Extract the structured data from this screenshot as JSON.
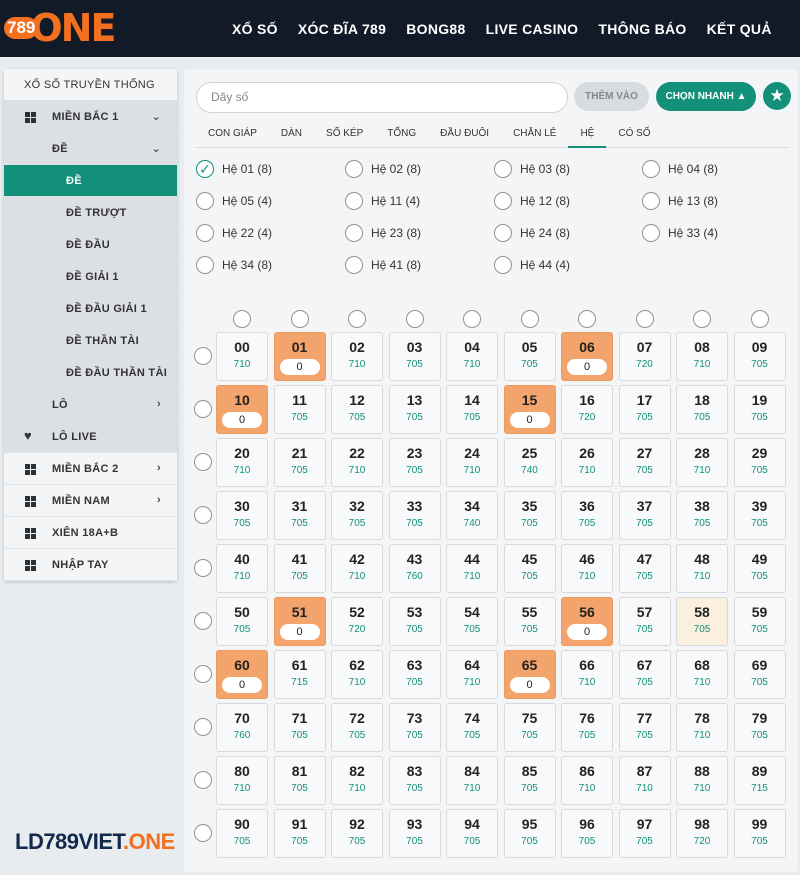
{
  "header": {
    "logo_num": "789",
    "logo_text": "ONE",
    "nav": [
      "XỔ SỐ",
      "XÓC ĐĨA 789",
      "BONG88",
      "LIVE CASINO",
      "THÔNG BÁO",
      "KẾT QUẢ"
    ]
  },
  "sidebar": {
    "items": [
      {
        "label": "XỔ SỐ TRUYỀN THỐNG",
        "icon": "",
        "chev": ""
      },
      {
        "label": "MIỀN BẮC 1",
        "icon": "grid-icon",
        "chev": "⌄"
      },
      {
        "label": "ĐỀ",
        "icon": "",
        "chev": "⌄"
      },
      {
        "label": "ĐỀ",
        "icon": "",
        "chev": ""
      },
      {
        "label": "ĐỀ TRƯỢT",
        "icon": "",
        "chev": ""
      },
      {
        "label": "ĐỀ ĐẦU",
        "icon": "",
        "chev": ""
      },
      {
        "label": "ĐỀ GIẢI 1",
        "icon": "",
        "chev": ""
      },
      {
        "label": "ĐỀ ĐẦU GIẢI 1",
        "icon": "",
        "chev": ""
      },
      {
        "label": "ĐỀ THẦN TÀI",
        "icon": "",
        "chev": ""
      },
      {
        "label": "ĐỀ ĐẦU THẦN TÀI",
        "icon": "",
        "chev": ""
      },
      {
        "label": "LÔ",
        "icon": "",
        "chev": "›"
      },
      {
        "label": "LÔ LIVE",
        "icon": "heart-icon",
        "chev": ""
      },
      {
        "label": "MIỀN BẮC 2",
        "icon": "grid-icon",
        "chev": "›"
      },
      {
        "label": "MIỀN NAM",
        "icon": "grid-icon",
        "chev": "›"
      },
      {
        "label": "XIÊN 18A+B",
        "icon": "grid-icon",
        "chev": ""
      },
      {
        "label": "NHẬP TAY",
        "icon": "grid-icon",
        "chev": ""
      }
    ]
  },
  "toolbar": {
    "search_placeholder": "Dãy số",
    "add_label": "THÊM VÀO",
    "quick_label": "CHỌN NHANH ▲",
    "star": "★"
  },
  "tabs": [
    "CON GIÁP",
    "DÀN",
    "SỐ KÉP",
    "TỔNG",
    "ĐẦU ĐUÔI",
    "CHẴN LẺ",
    "HỆ",
    "CÓ SỐ"
  ],
  "active_tab": "HỆ",
  "he_options": [
    "Hệ 01 (8)",
    "Hệ 02 (8)",
    "Hệ 03 (8)",
    "Hệ 04 (8)",
    "Hệ 05 (4)",
    "Hệ 11 (4)",
    "Hệ 12 (8)",
    "Hệ 13 (8)",
    "Hệ 22 (4)",
    "Hệ 23 (8)",
    "Hệ 24 (8)",
    "Hệ 33 (4)",
    "Hệ 34 (8)",
    "Hệ 41 (8)",
    "Hệ 44 (4)"
  ],
  "checked_option": "Hệ 01 (8)",
  "grid": {
    "odds": [
      [
        "710",
        "",
        "710",
        "705",
        "710",
        "705",
        "",
        "720",
        "710",
        "705"
      ],
      [
        "",
        "705",
        "705",
        "705",
        "705",
        "",
        "720",
        "705",
        "705",
        "705"
      ],
      [
        "710",
        "705",
        "710",
        "705",
        "710",
        "740",
        "710",
        "705",
        "710",
        "705"
      ],
      [
        "705",
        "705",
        "705",
        "705",
        "740",
        "705",
        "705",
        "705",
        "705",
        "705"
      ],
      [
        "710",
        "705",
        "710",
        "760",
        "710",
        "705",
        "710",
        "705",
        "710",
        "705"
      ],
      [
        "705",
        "",
        "720",
        "705",
        "705",
        "705",
        "",
        "705",
        "705",
        "705"
      ],
      [
        "",
        "715",
        "710",
        "705",
        "710",
        "",
        "710",
        "705",
        "710",
        "705"
      ],
      [
        "760",
        "705",
        "705",
        "705",
        "705",
        "705",
        "705",
        "705",
        "710",
        "705"
      ],
      [
        "710",
        "705",
        "710",
        "705",
        "710",
        "705",
        "710",
        "710",
        "710",
        "715"
      ],
      [
        "705",
        "705",
        "705",
        "705",
        "705",
        "705",
        "705",
        "705",
        "720",
        "705"
      ]
    ],
    "selected": [
      "01",
      "06",
      "10",
      "15",
      "51",
      "56",
      "60",
      "65"
    ],
    "stake": "0",
    "hover": "58"
  },
  "footer": {
    "brand_main": "LD789VIET",
    "brand_sub": ".ONE"
  }
}
